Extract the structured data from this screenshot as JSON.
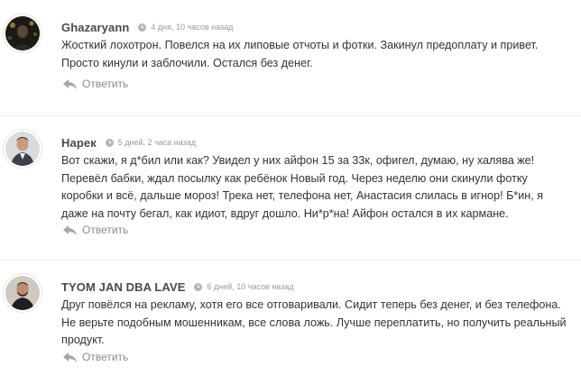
{
  "comments": [
    {
      "author": "Ghazaryann",
      "time": "4 дня, 10 часов назад",
      "text": "Жосткий лохотрон. Повелся на их липовые отчоты и фотки. Закинул предоплату и привет. Просто кинули и заблочили. Остался без денег.",
      "reply_label": "Ответить",
      "avatar_icon": "user-photo-dark-night"
    },
    {
      "author": "Нарек",
      "time": "5 дней, 2 часа назад",
      "text": "Вот скажи, я д*бил или как? Увидел у них айфон 15 за 33к, офигел, думаю, ну халява же! Перевёл бабки, ждал посылку как ребёнок Новый год. Через неделю они скинули фотку коробки и всё, дальше мороз! Трека нет, телефона нет, Анастасия слилась в игнор! Б*ин, я даже на почту бегал, как идиот, вдруг дошло. Ни*р*на! Айфон остался в их кармане.",
      "reply_label": "Ответить",
      "avatar_icon": "user-photo-man-suit"
    },
    {
      "author": "TYOM JAN DBA LAVE",
      "time": "6 дней, 10 часов назад",
      "text": "Друг повёлся на рекламу, хотя его все отговаривали. Сидит теперь без денег, и без телефона. Не верьте подобным мошенникам, все слова ложь. Лучше переплатить, но получить реальный продукт.",
      "reply_label": "Ответить",
      "avatar_icon": "user-photo-man-beard"
    }
  ],
  "colors": {
    "author": "#4a4a4a",
    "time": "#9a9a9a",
    "text": "#333333",
    "reply": "#8a8a8a"
  }
}
